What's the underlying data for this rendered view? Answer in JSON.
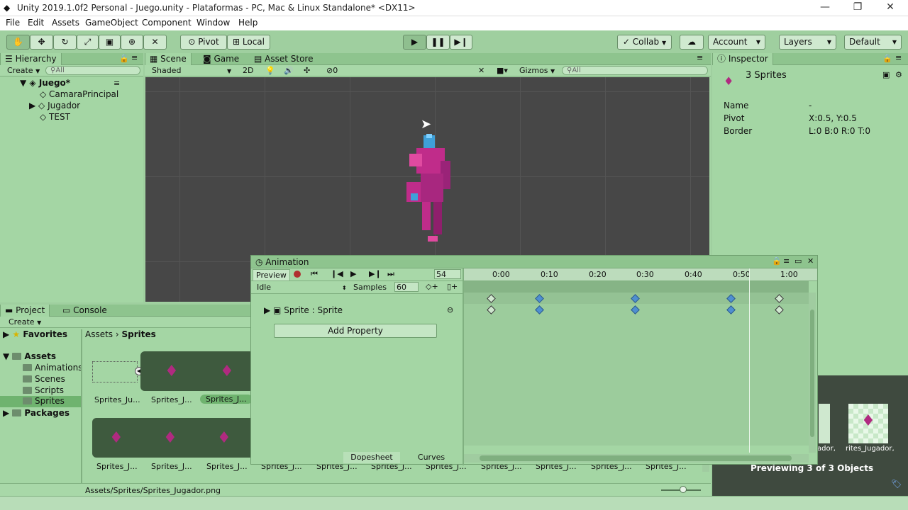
{
  "window": {
    "title": "Unity 2019.1.0f2 Personal - Juego.unity - Plataformas - PC, Mac & Linux Standalone* <DX11>"
  },
  "menu": [
    "File",
    "Edit",
    "Assets",
    "GameObject",
    "Component",
    "Window",
    "Help"
  ],
  "toolbar": {
    "pivot": "Pivot",
    "local": "Local",
    "collab": "Collab",
    "account": "Account",
    "layers": "Layers",
    "layout": "Default"
  },
  "hierarchy": {
    "tab": "Hierarchy",
    "create": "Create",
    "search_placeholder": "All",
    "scene": "Juego*",
    "items": [
      "CamaraPrincipal",
      "Jugador",
      "TEST"
    ]
  },
  "scene": {
    "tabs": [
      "Scene",
      "Game",
      "Asset Store"
    ],
    "shading": "Shaded",
    "mode2d": "2D",
    "gizmos": "Gizmos",
    "search_placeholder": "All",
    "hidden_count": "0"
  },
  "inspector": {
    "tab": "Inspector",
    "title": "3 Sprites",
    "fields": [
      {
        "k": "Name",
        "v": "-"
      },
      {
        "k": "Pivot",
        "v": "X:0.5, Y:0.5"
      },
      {
        "k": "Border",
        "v": "L:0 B:0 R:0 T:0"
      }
    ],
    "preview_text": "Previewing 3 of 3 Objects",
    "preview_labels": [
      "ador,",
      "rites_Jugador,"
    ]
  },
  "animation": {
    "title": "Animation",
    "preview": "Preview",
    "frame": "54",
    "clip": "Idle",
    "samples_label": "Samples",
    "samples": "60",
    "property": "Sprite : Sprite",
    "add_property": "Add Property",
    "ticks": [
      "0:00",
      "0:10",
      "0:20",
      "0:30",
      "0:40",
      "0:50",
      "1:00"
    ],
    "footer_tabs": [
      "Dopesheet",
      "Curves"
    ]
  },
  "project": {
    "tabs": [
      "Project",
      "Console"
    ],
    "create": "Create",
    "breadcrumb": [
      "Assets",
      "Sprites"
    ],
    "tree": [
      {
        "label": "Favorites",
        "bold": true
      },
      {
        "label": "Assets",
        "bold": true
      },
      {
        "label": "Animations"
      },
      {
        "label": "Scenes"
      },
      {
        "label": "Scripts"
      },
      {
        "label": "Sprites"
      },
      {
        "label": "Packages",
        "bold": true
      }
    ],
    "row1": [
      "Sprites_Ju...",
      "Sprites_J...",
      "Sprites_J..."
    ],
    "row2": [
      "Sprites_J...",
      "Sprites_J...",
      "Sprites_J...",
      "Sprites_J...",
      "Sprites_J...",
      "Sprites_J...",
      "Sprites_J...",
      "Sprites_J...",
      "Sprites_J...",
      "Sprites_J...",
      "Sprites_J...",
      "Sprites_J..."
    ],
    "path": "Assets/Sprites/Sprites_Jugador.png"
  },
  "colors": {
    "panel": "#a4d6a4",
    "scene_bg": "#474747",
    "key_blue": "#4f8fd0",
    "record": "#b03030"
  }
}
